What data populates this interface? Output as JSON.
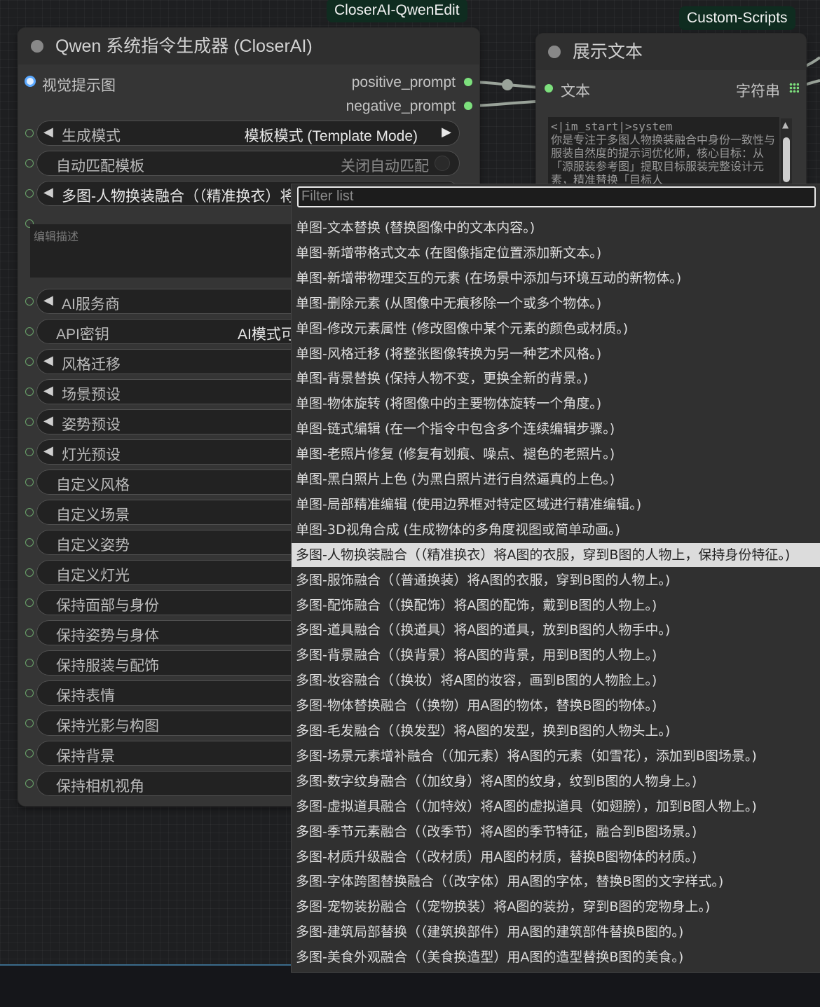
{
  "groups": {
    "qwenedit": "CloserAI-QwenEdit",
    "custom_scripts": "Custom-Scripts"
  },
  "generator_node": {
    "title": "Qwen 系统指令生成器 (CloserAI)",
    "input_image_label": "视觉提示图",
    "outputs": [
      "positive_prompt",
      "negative_prompt"
    ],
    "mode": {
      "label": "生成模式",
      "value": "模板模式 (Template Mode)"
    },
    "auto_match": {
      "label": "自动匹配模板",
      "value": "关闭自动匹配"
    },
    "template_visible": "多图-人物换装融合（（精准换衣）将",
    "description_placeholder": "编辑描述",
    "ai_provider": "AI服务商",
    "api_key": {
      "label": "API密钥",
      "value": "AI模式可"
    },
    "style_transfer": "风格迁移",
    "scene_preset": "场景预设",
    "pose_preset": "姿势预设",
    "light_preset": "灯光预设",
    "custom_widgets": [
      "自定义风格",
      "自定义场景",
      "自定义姿势",
      "自定义灯光"
    ],
    "keep_widgets": [
      "保持面部与身份",
      "保持姿势与身体",
      "保持服装与配饰",
      "保持表情",
      "保持光影与构图",
      "保持背景",
      "保持相机视角"
    ]
  },
  "display_node": {
    "title": "展示文本",
    "input_label": "文本",
    "output_label": "字符串",
    "content": "<|im_start|>system\n你是专注于多图人物换装融合中身份一致性与服装自然度的提示词优化师，核心目标：从「源服装参考图」提取目标服装完整设计元素，精准替换「目标人"
  },
  "dropdown": {
    "filter_placeholder": "Filter list",
    "selected_index": 13,
    "items": [
      "单图-文本替换 (替换图像中的文本内容。)",
      "单图-新增带格式文本 (在图像指定位置添加新文本。)",
      "单图-新增带物理交互的元素 (在场景中添加与环境互动的新物体。)",
      "单图-删除元素 (从图像中无痕移除一个或多个物体。)",
      "单图-修改元素属性 (修改图像中某个元素的颜色或材质。)",
      "单图-风格迁移 (将整张图像转换为另一种艺术风格。)",
      "单图-背景替换 (保持人物不变，更换全新的背景。)",
      "单图-物体旋转 (将图像中的主要物体旋转一个角度。)",
      "单图-链式编辑 (在一个指令中包含多个连续编辑步骤。)",
      "单图-老照片修复 (修复有划痕、噪点、褪色的老照片。)",
      "单图-黑白照片上色 (为黑白照片进行自然逼真的上色。)",
      "单图-局部精准编辑 (使用边界框对特定区域进行精准编辑。)",
      "单图-3D视角合成 (生成物体的多角度视图或简单动画。)",
      "多图-人物换装融合（（精准换衣）将A图的衣服，穿到B图的人物上，保持身份特征。)",
      "多图-服饰融合（（普通换装）将A图的衣服，穿到B图的人物上。)",
      "多图-配饰融合（（换配饰）将A图的配饰，戴到B图的人物上。)",
      "多图-道具融合（（换道具）将A图的道具，放到B图的人物手中。)",
      "多图-背景融合（（换背景）将A图的背景，用到B图的人物上。)",
      "多图-妆容融合（（换妆）将A图的妆容，画到B图的人物脸上。)",
      "多图-物体替换融合（（换物）用A图的物体，替换B图的物体。)",
      "多图-毛发融合（（换发型）将A图的发型，换到B图的人物头上。)",
      "多图-场景元素增补融合（（加元素）将A图的元素（如雪花），添加到B图场景。)",
      "多图-数字纹身融合（（加纹身）将A图的纹身，纹到B图的人物身上。)",
      "多图-虚拟道具融合（（加特效）将A图的虚拟道具（如翅膀），加到B图人物上。)",
      "多图-季节元素融合（（改季节）将A图的季节特征，融合到B图场景。)",
      "多图-材质升级融合（（改材质）用A图的材质，替换B图物体的材质。)",
      "多图-字体跨图替换融合（（改字体）用A图的字体，替换B图的文字样式。)",
      "多图-宠物装扮融合（（宠物换装）将A图的装扮，穿到B图的宠物身上。)",
      "多图-建筑局部替换（（建筑换部件）用A图的建筑部件替换B图的。)",
      "多图-美食外观融合（（美食换造型）用A图的造型替换B图的美食。)"
    ]
  },
  "colors": {
    "output_dot": "#7de07d",
    "input_image_dot": "#5aa8ff",
    "group_label_bg": "#0f2c20"
  }
}
